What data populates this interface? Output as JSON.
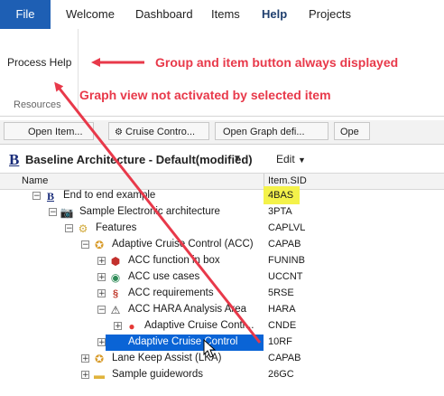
{
  "menu": {
    "file": "File",
    "items": [
      "Welcome",
      "Dashboard",
      "Items",
      "Help",
      "Projects"
    ],
    "active": "Help"
  },
  "ribbon": {
    "button": "Process Help",
    "group": "Resources"
  },
  "annotations": {
    "top": "Group and item button always displayed",
    "mid": "Graph view not activated by selected item",
    "color": "#e8394a"
  },
  "toolbar": {
    "buttons": [
      "Open Item...",
      "Cruise Contro...",
      "Open Graph defi...",
      "Ope"
    ]
  },
  "view": {
    "title": "Baseline Architecture - Default(modified)",
    "edit": "Edit"
  },
  "tree": {
    "col_name": "Name",
    "col_sid": "Item.SID",
    "rows": [
      {
        "label": "End to end example",
        "sid": "4BAS",
        "icon": "baseline-b-icon",
        "exp": "−",
        "highlight": true
      },
      {
        "label": "Sample Electronic architecture",
        "sid": "3PTA",
        "icon": "camera-icon",
        "exp": "−"
      },
      {
        "label": "Features",
        "sid": "CAPLVL",
        "icon": "folder-gear-icon",
        "exp": "−"
      },
      {
        "label": "Adaptive Cruise Control (ACC)",
        "sid": "CAPAB",
        "icon": "capability-icon",
        "exp": "−"
      },
      {
        "label": "ACC function in box",
        "sid": "FUNINB",
        "icon": "function-box-icon",
        "exp": "+"
      },
      {
        "label": "ACC use cases",
        "sid": "UCCNT",
        "icon": "use-case-icon",
        "exp": "+"
      },
      {
        "label": "ACC requirements",
        "sid": "5RSE",
        "icon": "requirements-icon",
        "exp": "+"
      },
      {
        "label": "ACC HARA Analysis Area",
        "sid": "HARA",
        "icon": "hazard-icon",
        "exp": "−"
      },
      {
        "label": "Adaptive Cruise Contr...",
        "sid": "CNDE",
        "icon": "red-hazard-icon",
        "exp": "+"
      },
      {
        "label": "Adaptive Cruise Control",
        "sid": "10RF",
        "icon": "graph-view-icon",
        "exp": "+",
        "selected": true
      },
      {
        "label": "Lane Keep Assist (LKA)",
        "sid": "CAPAB",
        "icon": "capability-icon",
        "exp": "+"
      },
      {
        "label": "Sample guidewords",
        "sid": "26GC",
        "icon": "folder-icon",
        "exp": "+"
      }
    ]
  }
}
